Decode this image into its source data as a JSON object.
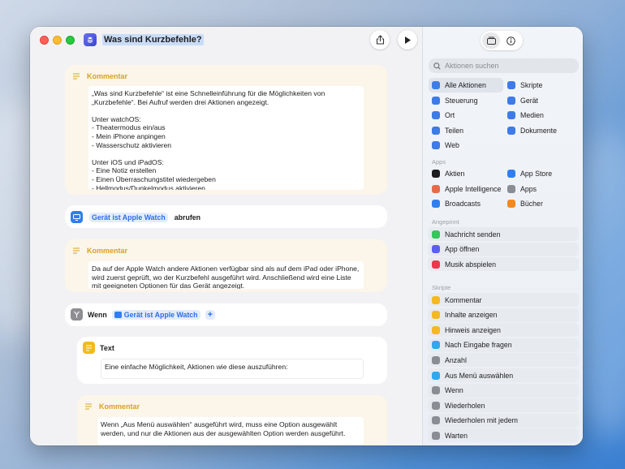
{
  "window": {
    "title": "Was sind Kurzbefehle?"
  },
  "editor": {
    "comment1": {
      "label": "Kommentar",
      "text": "„Was sind Kurzbefehle“ ist eine Schnelleinführung für die Möglichkeiten von „Kurzbefehle“. Bei Aufruf werden drei Aktionen angezeigt.\n\nUnter watchOS:\n- Theatermodus ein/aus\n- Mein iPhone anpingen\n- Wasserschutz aktivieren\n\nUnter iOS und iPadOS:\n- Eine Notiz erstellen\n- Einen Überraschungstitel wiedergeben\n- Hellmodus/Dunkelmodus aktivieren"
    },
    "device_action": {
      "token": "Gerät ist Apple Watch",
      "verb": "abrufen"
    },
    "comment2": {
      "label": "Kommentar",
      "text": "Da auf der Apple Watch andere Aktionen verfügbar sind als auf dem iPad oder iPhone, wird zuerst geprüft, wo der Kurzbefehl ausgeführt wird. Anschließend wird eine Liste mit geeigneten Optionen für das Gerät angezeigt."
    },
    "if_action": {
      "label": "Wenn",
      "token": "Gerät ist Apple Watch",
      "add": "+"
    },
    "text_action": {
      "label": "Text",
      "text": "Eine einfache Möglichkeit, Aktionen wie diese auszuführen:"
    },
    "comment3": {
      "label": "Kommentar",
      "text": "Wenn „Aus Menü auswählen“ ausgeführt wird, muss eine Option ausgewählt werden, und nur die Aktionen aus der ausgewählten Option werden ausgeführt."
    }
  },
  "sidebar": {
    "search_placeholder": "Aktionen suchen",
    "categories_left": [
      {
        "label": "Alle Aktionen",
        "icon": "list-icon",
        "color": "#3d7be6",
        "selected": true
      },
      {
        "label": "Steuerung",
        "icon": "toggle-icon",
        "color": "#3d7be6"
      },
      {
        "label": "Ort",
        "icon": "location-icon",
        "color": "#3d7be6"
      },
      {
        "label": "Teilen",
        "icon": "share-icon",
        "color": "#3d7be6"
      },
      {
        "label": "Web",
        "icon": "compass-icon",
        "color": "#3d7be6"
      }
    ],
    "categories_right": [
      {
        "label": "Skripte",
        "icon": "script-icon",
        "color": "#3d7be6"
      },
      {
        "label": "Gerät",
        "icon": "display-icon",
        "color": "#3d7be6"
      },
      {
        "label": "Medien",
        "icon": "music-icon",
        "color": "#3d7be6"
      },
      {
        "label": "Dokumente",
        "icon": "document-icon",
        "color": "#3d7be6"
      }
    ],
    "apps_label": "Apps",
    "apps_left": [
      {
        "label": "Aktien",
        "icon": "stocks-icon",
        "color": "#1d1d1f"
      },
      {
        "label": "Apple Intelligence",
        "icon": "apple-intelligence-icon",
        "color": "#e86a4a"
      },
      {
        "label": "Broadcasts",
        "icon": "broadcast-icon",
        "color": "#2f7ff0"
      }
    ],
    "apps_right": [
      {
        "label": "App Store",
        "icon": "app-store-icon",
        "color": "#2f7ff0"
      },
      {
        "label": "Apps",
        "icon": "apps-icon",
        "color": "#8a8d93"
      },
      {
        "label": "Bücher",
        "icon": "books-icon",
        "color": "#f08a24"
      }
    ],
    "pinned_label": "Angepinnt",
    "pinned": [
      {
        "label": "Nachricht senden",
        "icon": "message-icon",
        "color": "#34c759"
      },
      {
        "label": "App öffnen",
        "icon": "open-app-icon",
        "color": "#5b5ef0"
      },
      {
        "label": "Musik abspielen",
        "icon": "music-icon",
        "color": "#f0364a"
      }
    ],
    "scripts_label": "Skripte",
    "scripts": [
      {
        "label": "Kommentar",
        "icon": "comment-icon",
        "color": "#f5b820"
      },
      {
        "label": "Inhalte anzeigen",
        "icon": "show-icon",
        "color": "#f5b820"
      },
      {
        "label": "Hinweis anzeigen",
        "icon": "alert-icon",
        "color": "#f5b820"
      },
      {
        "label": "Nach Eingabe fragen",
        "icon": "ask-icon",
        "color": "#2fa8f0"
      },
      {
        "label": "Anzahl",
        "icon": "count-icon",
        "color": "#8a8d93"
      },
      {
        "label": "Aus Menü auswählen",
        "icon": "menu-icon",
        "color": "#2fa8f0"
      },
      {
        "label": "Wenn",
        "icon": "if-icon",
        "color": "#8a8d93"
      },
      {
        "label": "Wiederholen",
        "icon": "repeat-icon",
        "color": "#8a8d93"
      },
      {
        "label": "Wiederholen mit jedem",
        "icon": "repeat-each-icon",
        "color": "#8a8d93"
      },
      {
        "label": "Warten",
        "icon": "wait-icon",
        "color": "#8a8d93"
      }
    ]
  }
}
